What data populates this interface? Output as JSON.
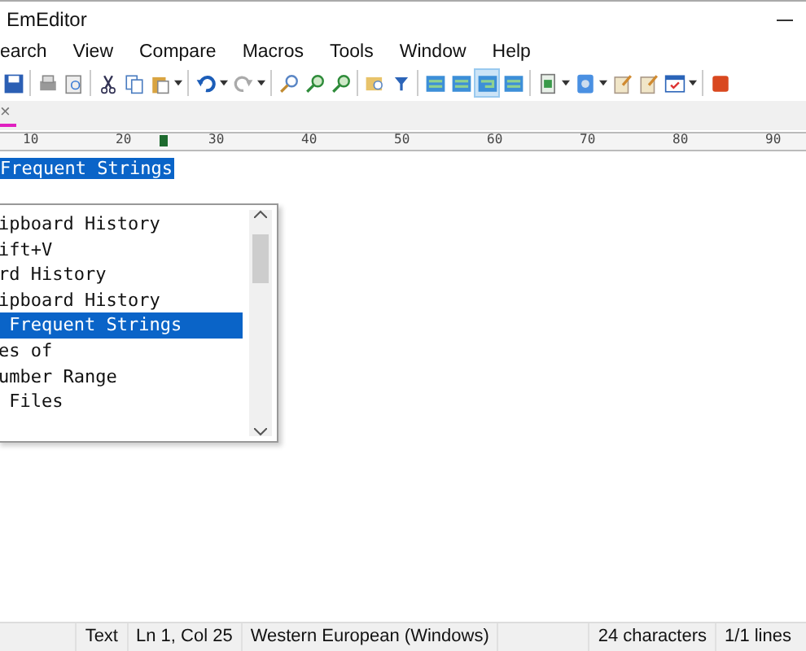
{
  "window": {
    "title": "EmEditor"
  },
  "menu": [
    {
      "label": "earch"
    },
    {
      "label": "View"
    },
    {
      "label": "Compare"
    },
    {
      "label": "Macros"
    },
    {
      "label": "Tools"
    },
    {
      "label": "Window"
    },
    {
      "label": "Help"
    }
  ],
  "toolbar": [
    {
      "kind": "save",
      "pressed": false
    },
    {
      "kind": "sep"
    },
    {
      "kind": "print",
      "pressed": false
    },
    {
      "kind": "preview",
      "pressed": false
    },
    {
      "kind": "sep"
    },
    {
      "kind": "cut",
      "pressed": false
    },
    {
      "kind": "copy",
      "pressed": false
    },
    {
      "kind": "paste",
      "pressed": false
    },
    {
      "kind": "drop"
    },
    {
      "kind": "sep"
    },
    {
      "kind": "undo",
      "pressed": false
    },
    {
      "kind": "drop"
    },
    {
      "kind": "redo",
      "pressed": false
    },
    {
      "kind": "drop"
    },
    {
      "kind": "sep"
    },
    {
      "kind": "find",
      "pressed": false
    },
    {
      "kind": "findnext",
      "pressed": false
    },
    {
      "kind": "findprev",
      "pressed": false
    },
    {
      "kind": "sep"
    },
    {
      "kind": "findfiles",
      "pressed": false
    },
    {
      "kind": "filter",
      "pressed": false
    },
    {
      "kind": "sep"
    },
    {
      "kind": "panel",
      "pressed": false
    },
    {
      "kind": "panel",
      "pressed": false
    },
    {
      "kind": "wrap",
      "pressed": true
    },
    {
      "kind": "panel",
      "pressed": false
    },
    {
      "kind": "sep"
    },
    {
      "kind": "doc",
      "pressed": false
    },
    {
      "kind": "drop"
    },
    {
      "kind": "tool",
      "pressed": false
    },
    {
      "kind": "drop"
    },
    {
      "kind": "note",
      "pressed": false
    },
    {
      "kind": "note",
      "pressed": false
    },
    {
      "kind": "check",
      "pressed": false
    },
    {
      "kind": "drop"
    },
    {
      "kind": "sep"
    },
    {
      "kind": "stop",
      "pressed": false
    }
  ],
  "ruler": [
    "10",
    "20",
    "30",
    "40",
    "50",
    "60",
    "70",
    "80",
    "90"
  ],
  "tab": {
    "close": "×"
  },
  "editor": {
    "line": "Frequent Strings"
  },
  "popup": {
    "items": [
      {
        "label": "ipboard History",
        "selected": false
      },
      {
        "label": "ift+V",
        "selected": false
      },
      {
        "label": "rd History",
        "selected": false
      },
      {
        "label": "ipboard History",
        "selected": false
      },
      {
        "label": " Frequent Strings",
        "selected": true
      },
      {
        "label": "es of",
        "selected": false
      },
      {
        "label": "umber Range",
        "selected": false
      },
      {
        "label": " Files",
        "selected": false
      }
    ]
  },
  "status_bar": [
    {
      "text": "Text"
    },
    {
      "text": "Ln 1, Col 25"
    },
    {
      "text": "Western European (Windows)"
    },
    {
      "kind": "blank"
    },
    {
      "text": "24 characters"
    },
    {
      "text": "1/1 lines"
    }
  ]
}
